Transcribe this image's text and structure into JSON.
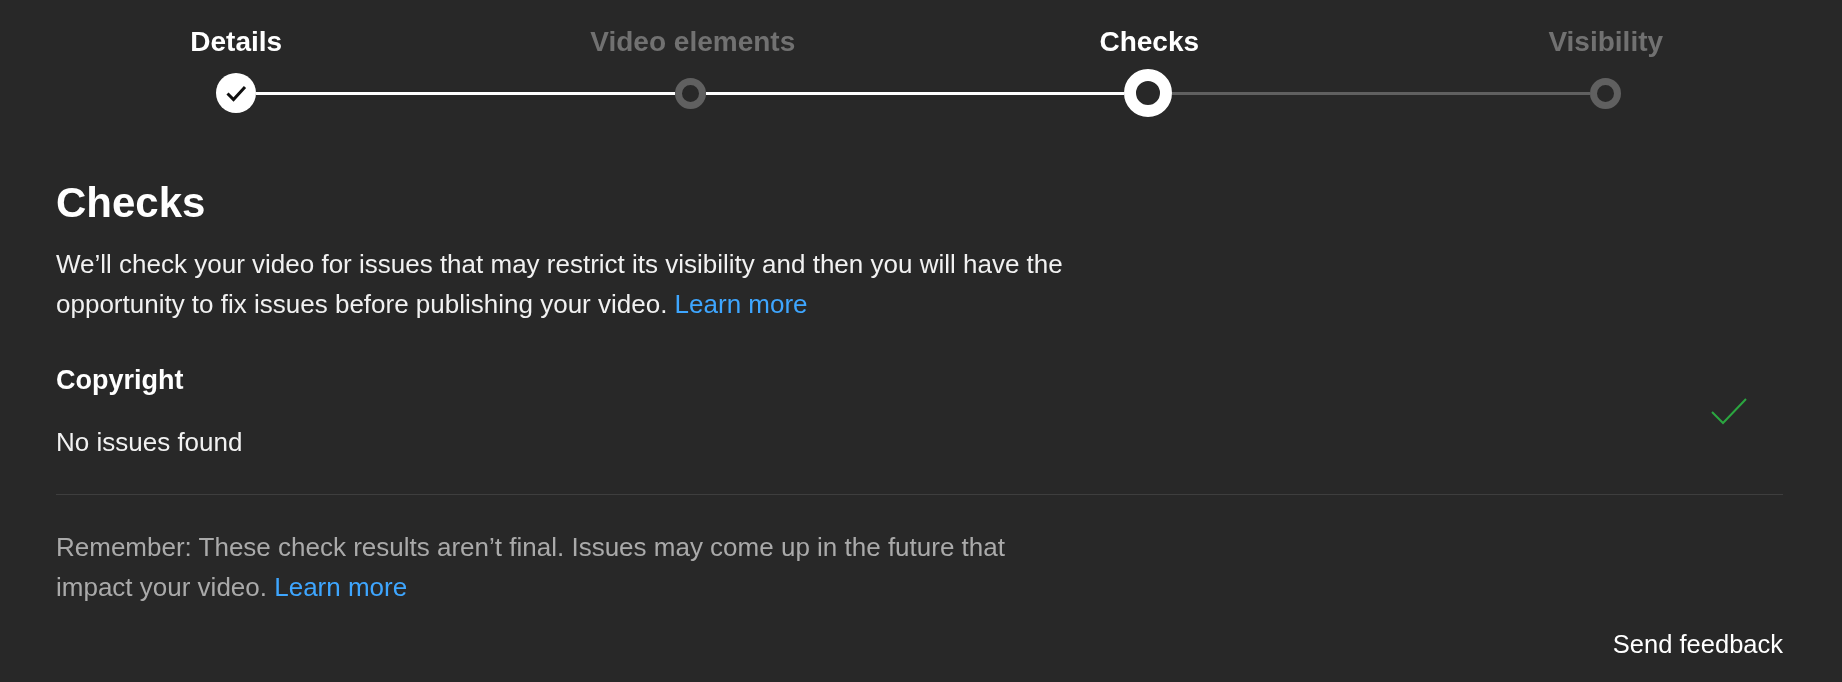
{
  "steps": [
    {
      "label": "Details",
      "completed": true,
      "selected": false
    },
    {
      "label": "Video elements",
      "completed": false,
      "selected": false
    },
    {
      "label": "Checks",
      "completed": false,
      "selected": true
    },
    {
      "label": "Visibility",
      "completed": false,
      "selected": false
    }
  ],
  "heading": "Checks",
  "intro": {
    "text": "We’ll check your video for issues that may restrict its visibility and then you will have the opportunity to fix issues before publishing your video.",
    "link": "Learn more"
  },
  "checks": [
    {
      "title": "Copyright",
      "status": "No issues found",
      "passed": true
    }
  ],
  "note": {
    "text": "Remember: These check results aren’t final. Issues may come up in the future that impact your video.",
    "link": "Learn more"
  },
  "feedback_button": "Send feedback"
}
